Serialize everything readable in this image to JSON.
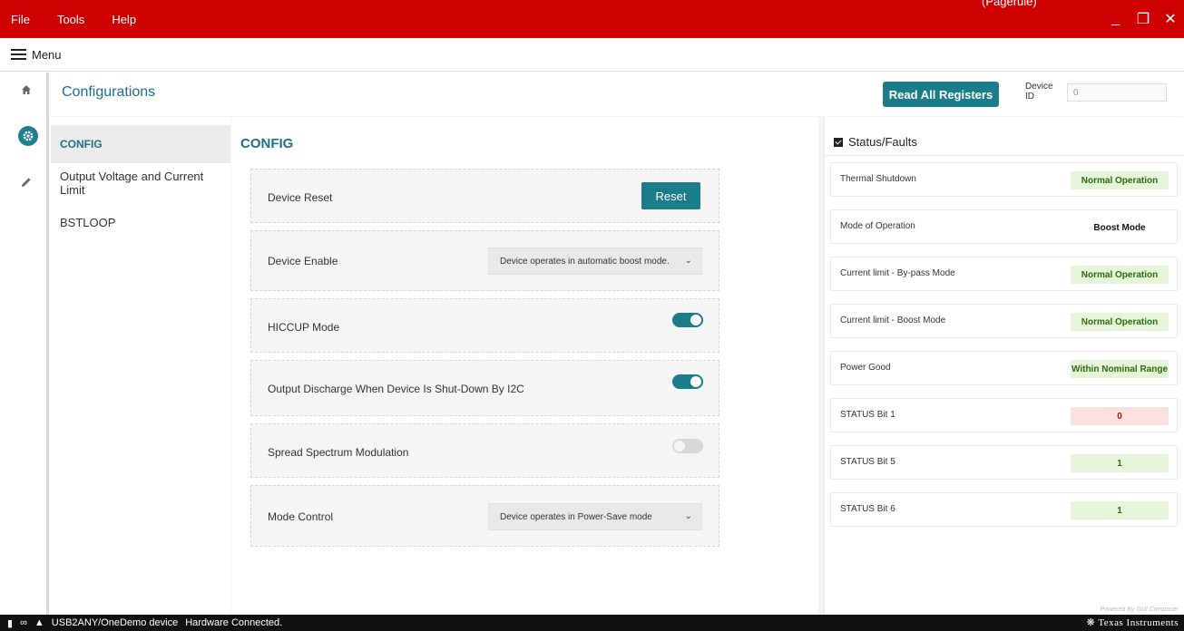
{
  "menubar": {
    "items": [
      "File",
      "Tools",
      "Help"
    ],
    "top_link": "(Pagerule)",
    "min_icon": "_",
    "restore_icon": "❐",
    "close_icon": "✕"
  },
  "nav": {
    "menu_label": "Menu"
  },
  "header": {
    "title": "Configurations",
    "read_all_label": "Read All Registers",
    "device_id_label": "Device ID",
    "device_id_value": "0"
  },
  "subnav": {
    "items": [
      "CONFIG",
      "Output Voltage and Current Limit",
      "BSTLOOP"
    ],
    "active_index": 0
  },
  "config": {
    "title": "CONFIG",
    "device_reset": {
      "label": "Device Reset",
      "button": "Reset"
    },
    "device_enable": {
      "label": "Device Enable",
      "value": "Device operates in automatic boost mode."
    },
    "hiccup": {
      "label": "HICCUP Mode",
      "on": true
    },
    "output_discharge": {
      "label": "Output Discharge When Device Is Shut-Down By I2C",
      "on": true
    },
    "spread_spectrum": {
      "label": "Spread Spectrum Modulation",
      "on": false
    },
    "mode_control": {
      "label": "Mode Control",
      "value": "Device operates in Power-Save mode"
    }
  },
  "status": {
    "title": "Status/Faults",
    "rows": [
      {
        "label": "Thermal Shutdown",
        "value": "Normal Operation",
        "state": "good"
      },
      {
        "label": "Mode of Operation",
        "value": "Boost Mode",
        "state": "plain"
      },
      {
        "label": "Current limit - By-pass Mode",
        "value": "Normal Operation",
        "state": "good"
      },
      {
        "label": "Current limit - Boost Mode",
        "value": "Normal Operation",
        "state": "good"
      },
      {
        "label": "Power Good",
        "value": "Within Nominal Range",
        "state": "good"
      },
      {
        "label": "STATUS Bit 1",
        "value": "0",
        "state": "bad"
      },
      {
        "label": "STATUS Bit 5",
        "value": "1",
        "state": "good"
      },
      {
        "label": "STATUS Bit 6",
        "value": "1",
        "state": "good"
      }
    ],
    "powered_by": "Powered By GUI Composer"
  },
  "bottom": {
    "device_text": "USB2ANY/OneDemo device",
    "connection_text": "Hardware Connected.",
    "brand": "Texas Instruments"
  },
  "colors": {
    "topbar": "#cc0000",
    "accent": "#1b7c8a",
    "title": "#1f6f8b",
    "good_bg": "#e6f5d9",
    "bad_bg": "#fbe1dc"
  }
}
